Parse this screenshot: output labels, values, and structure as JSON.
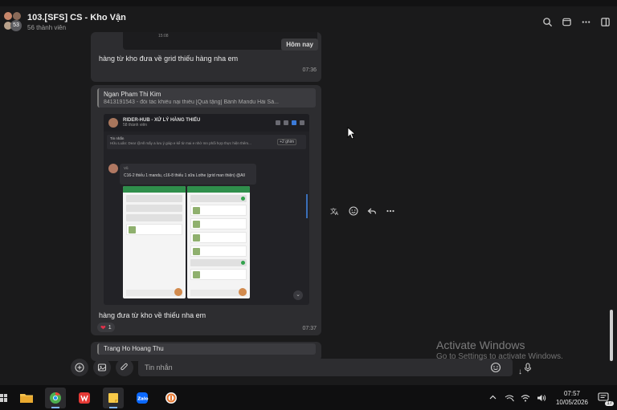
{
  "header": {
    "group_title": "103.[SFS] CS - Kho Vận",
    "member_count": "56 thành viên",
    "avatar_count": "53"
  },
  "messages": [
    {
      "today_label": "Hôm nay",
      "image_time": "15:08",
      "text": "hàng từ kho đưa về grid thiếu hàng nha em",
      "time": "07:36"
    },
    {
      "quote_name": "Ngan Pham Thi Kim",
      "quote_text": "8413191543 - đối tác khiếu nại thiếu [Quà tặng] Bánh Mandu Hải Sả...",
      "embed": {
        "title": "RIDER-HUB - XỬ LÝ HÀNG THIẾU",
        "subtitle": "58 thành viên",
        "pin_label": "Tin nhắn",
        "pin_text": "Hữu Luân: Dear @All mấy a lưu ý giúp e  kể từ mai e nhờ mn phối hợp thực hiện thêm...",
        "pin_more": "+2 ghim",
        "msg_name": "Vũ",
        "msg_text": "C16-2 thiếu 1 mandu, c16-8 thiếu 1 sữa Lothe (grid man thiện) @All"
      },
      "text": "hàng đưa từ kho về thiếu nha em",
      "reaction_count": "1",
      "time": "07:37"
    },
    {
      "quote_name": "Trang Ho Hoang Thu"
    }
  ],
  "composer": {
    "placeholder": "Tin nhắn"
  },
  "watermark": {
    "title": "Activate Windows",
    "subtitle": "Go to Settings to activate Windows."
  },
  "taskbar": {
    "time": "07:57",
    "date": "10/05/2026",
    "notification_count": "17"
  },
  "colors": {
    "background": "#1a1a1b",
    "bubble": "#2d2d30",
    "accent": "#3b7ad8",
    "heart": "#e0314a"
  }
}
